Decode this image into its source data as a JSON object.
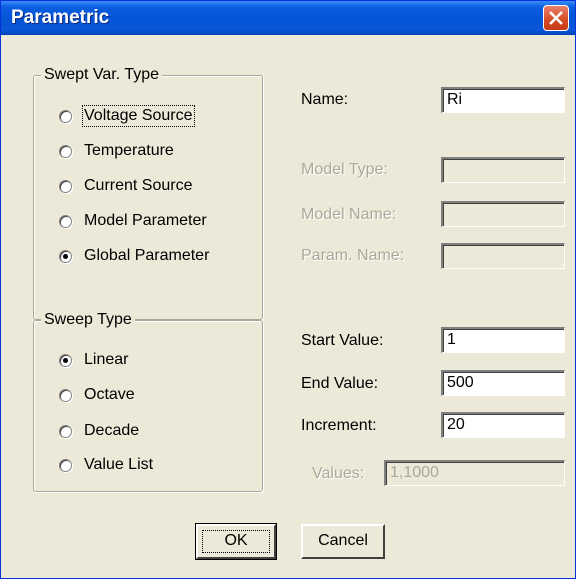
{
  "window": {
    "title": "Parametric"
  },
  "swept_var_type": {
    "legend": "Swept Var. Type",
    "options": [
      {
        "label": "Voltage Source",
        "checked": false
      },
      {
        "label": "Temperature",
        "checked": false
      },
      {
        "label": "Current Source",
        "checked": false
      },
      {
        "label": "Model Parameter",
        "checked": false
      },
      {
        "label": "Global Parameter",
        "checked": true
      }
    ]
  },
  "sweep_type": {
    "legend": "Sweep Type",
    "options": [
      {
        "label": "Linear",
        "checked": true
      },
      {
        "label": "Octave",
        "checked": false
      },
      {
        "label": "Decade",
        "checked": false
      },
      {
        "label": "Value List",
        "checked": false
      }
    ]
  },
  "fields": {
    "name": {
      "label": "Name:",
      "value": "Ri"
    },
    "model_type": {
      "label": "Model Type:",
      "value": ""
    },
    "model_name": {
      "label": "Model Name:",
      "value": ""
    },
    "param_name": {
      "label": "Param. Name:",
      "value": ""
    },
    "start_value": {
      "label": "Start Value:",
      "value": "1"
    },
    "end_value": {
      "label": "End Value:",
      "value": "500"
    },
    "increment": {
      "label": "Increment:",
      "value": "20"
    },
    "values": {
      "label": "Values:",
      "value": "1,1000"
    }
  },
  "buttons": {
    "ok": "OK",
    "cancel": "Cancel"
  }
}
